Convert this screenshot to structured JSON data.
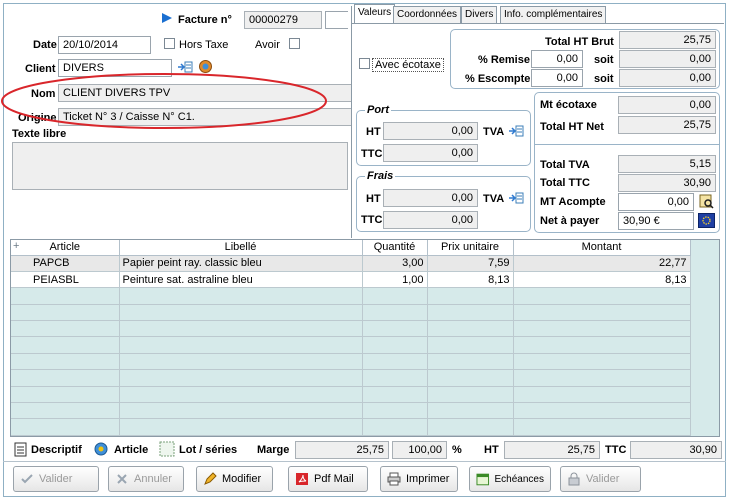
{
  "header": {
    "facture_label": "Facture n°",
    "facture_value": "00000279",
    "date_label": "Date",
    "date_value": "20/10/2014",
    "hors_taxe_label": "Hors Taxe",
    "avoir_label": "Avoir",
    "client_label": "Client",
    "client_value": "DIVERS",
    "nom_label": "Nom",
    "nom_value": "CLIENT DIVERS TPV",
    "origine_label": "Origine",
    "origine_value": "Ticket N° 3 / Caisse N° C1.",
    "texte_libre_label": "Texte libre"
  },
  "tabs": [
    "Valeurs",
    "Coordonnées",
    "Divers",
    "Info. complémentaires"
  ],
  "valeurs": {
    "avec_ecotaxe_label": "Avec écotaxe",
    "total_ht_brut_label": "Total HT Brut",
    "total_ht_brut_value": "25,75",
    "remise_label": "% Remise",
    "remise_value": "0,00",
    "escompte_label": "% Escompte",
    "escompte_value": "0,00",
    "soit_label": "soit",
    "remise_soit_value": "0,00",
    "escompte_soit_value": "0,00",
    "port_title": "Port",
    "frais_title": "Frais",
    "ht_label": "HT",
    "ttc_label": "TTC",
    "tva_label": "TVA",
    "port_ht": "0,00",
    "port_ttc": "0,00",
    "frais_ht": "0,00",
    "frais_ttc": "0,00",
    "mt_ecotaxe_label": "Mt écotaxe",
    "mt_ecotaxe_value": "0,00",
    "total_ht_net_label": "Total HT Net",
    "total_ht_net_value": "25,75",
    "total_tva_label": "Total TVA",
    "total_tva_value": "5,15",
    "total_ttc_label": "Total TTC",
    "total_ttc_value": "30,90",
    "mt_acompte_label": "MT Acompte",
    "mt_acompte_value": "0,00",
    "net_a_payer_label": "Net à payer",
    "net_a_payer_value": "30,90 €"
  },
  "grid": {
    "columns": [
      "Article",
      "Libellé",
      "Quantité",
      "Prix unitaire",
      "Montant"
    ],
    "rows": [
      [
        "PAPCB",
        "Papier peint ray. classic bleu",
        "3,00",
        "7,59",
        "22,77"
      ],
      [
        "PEIASBL",
        "Peinture sat. astraline bleu",
        "1,00",
        "8,13",
        "8,13"
      ]
    ],
    "empty_rows": 10
  },
  "footer": {
    "descriptif_label": "Descriptif",
    "article_label": "Article",
    "lot_series_label": "Lot / séries",
    "marge_label": "Marge",
    "marge_value": "25,75",
    "pct_value": "100,00",
    "pct_sign": "%",
    "ht_label": "HT",
    "ht_value": "25,75",
    "ttc_label": "TTC",
    "ttc_value": "30,90"
  },
  "buttons": {
    "valider": "Valider",
    "annuler": "Annuler",
    "modifier": "Modifier",
    "pdf_mail": "Pdf Mail",
    "imprimer": "Imprimer",
    "echeances": "Echéances",
    "valider2": "Valider"
  },
  "colors": {
    "annotation_red": "#d9262b",
    "grid_teal": "#d6eaea",
    "group_border": "#9ab4c8"
  }
}
